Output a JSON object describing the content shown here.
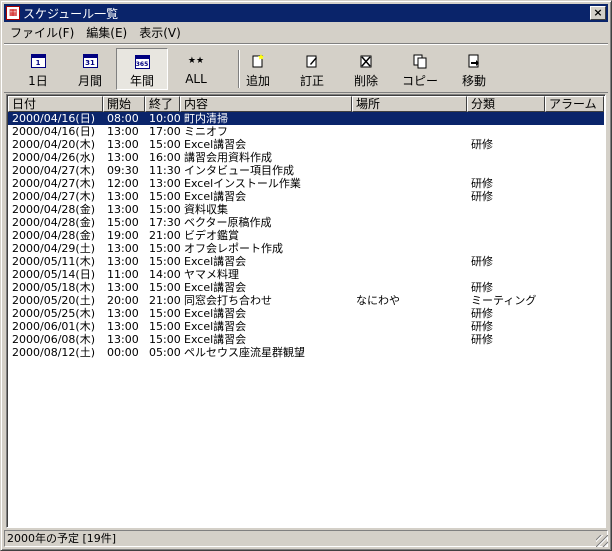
{
  "window": {
    "title": "スケジュール一覧",
    "close_label": "×"
  },
  "menu": {
    "items": [
      "ファイル(F)",
      "編集(E)",
      "表示(V)"
    ]
  },
  "toolbar": {
    "buttons": [
      {
        "label": "1日",
        "icon": "day-calendar-icon",
        "glyph": "1"
      },
      {
        "label": "月間",
        "icon": "month-calendar-icon",
        "glyph": "31"
      },
      {
        "label": "年間",
        "icon": "year-calendar-icon",
        "glyph": "365",
        "active": true
      },
      {
        "label": "ALL",
        "icon": "all-stars-icon",
        "glyph": "★★"
      },
      {
        "label": "追加",
        "icon": "add-icon"
      },
      {
        "label": "訂正",
        "icon": "edit-icon"
      },
      {
        "label": "削除",
        "icon": "delete-icon"
      },
      {
        "label": "コピー",
        "icon": "copy-icon"
      },
      {
        "label": "移動",
        "icon": "move-icon"
      }
    ]
  },
  "table": {
    "columns": [
      "日付",
      "開始",
      "終了",
      "内容",
      "場所",
      "分類",
      "アラーム"
    ],
    "selected_index": 0,
    "rows": [
      [
        "2000/04/16(日)",
        "08:00",
        "10:00",
        "町内清掃",
        "",
        "",
        ""
      ],
      [
        "2000/04/16(日)",
        "13:00",
        "17:00",
        "ミニオフ",
        "",
        "",
        ""
      ],
      [
        "2000/04/20(木)",
        "13:00",
        "15:00",
        "Excel講習会",
        "",
        "研修",
        ""
      ],
      [
        "2000/04/26(水)",
        "13:00",
        "16:00",
        "講習会用資料作成",
        "",
        "",
        ""
      ],
      [
        "2000/04/27(木)",
        "09:30",
        "11:30",
        "インタビュー項目作成",
        "",
        "",
        ""
      ],
      [
        "2000/04/27(木)",
        "12:00",
        "13:00",
        "Excelインストール作業",
        "",
        "研修",
        ""
      ],
      [
        "2000/04/27(木)",
        "13:00",
        "15:00",
        "Excel講習会",
        "",
        "研修",
        ""
      ],
      [
        "2000/04/28(金)",
        "13:00",
        "15:00",
        "資料収集",
        "",
        "",
        ""
      ],
      [
        "2000/04/28(金)",
        "15:00",
        "17:30",
        "ベクター原稿作成",
        "",
        "",
        ""
      ],
      [
        "2000/04/28(金)",
        "19:00",
        "21:00",
        "ビデオ鑑賞",
        "",
        "",
        ""
      ],
      [
        "2000/04/29(土)",
        "13:00",
        "15:00",
        "オフ会レポート作成",
        "",
        "",
        ""
      ],
      [
        "2000/05/11(木)",
        "13:00",
        "15:00",
        "Excel講習会",
        "",
        "研修",
        ""
      ],
      [
        "2000/05/14(日)",
        "11:00",
        "14:00",
        "ヤマメ料理",
        "",
        "",
        ""
      ],
      [
        "2000/05/18(木)",
        "13:00",
        "15:00",
        "Excel講習会",
        "",
        "研修",
        ""
      ],
      [
        "2000/05/20(土)",
        "20:00",
        "21:00",
        "同窓会打ち合わせ",
        "なにわや",
        "ミーティング",
        ""
      ],
      [
        "2000/05/25(木)",
        "13:00",
        "15:00",
        "Excel講習会",
        "",
        "研修",
        ""
      ],
      [
        "2000/06/01(木)",
        "13:00",
        "15:00",
        "Excel講習会",
        "",
        "研修",
        ""
      ],
      [
        "2000/06/08(木)",
        "13:00",
        "15:00",
        "Excel講習会",
        "",
        "研修",
        ""
      ],
      [
        "2000/08/12(土)",
        "00:00",
        "05:00",
        "ペルセウス座流星群観望",
        "",
        "",
        ""
      ]
    ]
  },
  "status": {
    "text": "2000年の予定 [19件]"
  },
  "colors": {
    "selection": "#0a246a",
    "face": "#d4d0c8"
  }
}
